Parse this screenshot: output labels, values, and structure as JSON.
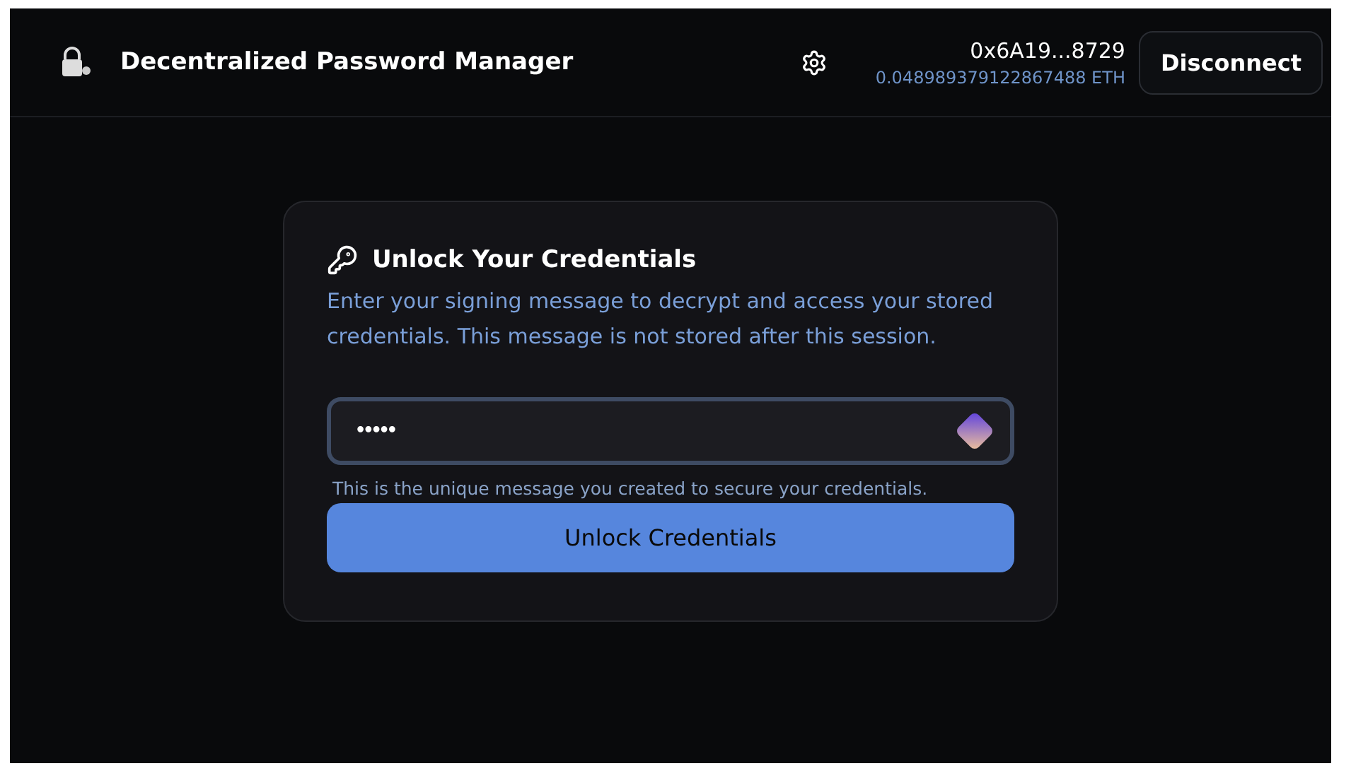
{
  "header": {
    "title": "Decentralized Password Manager",
    "address": "0x6A19...8729",
    "balance": "0.048989379122867488 ETH",
    "disconnect": "Disconnect"
  },
  "card": {
    "title": "Unlock Your Credentials",
    "description": "Enter your signing message to decrypt and access your stored credentials. This message is not stored after this session.",
    "field": {
      "value": "•••••",
      "focused": true
    },
    "hint": "This is the unique message you created to secure your credentials.",
    "button": "Unlock Credentials"
  }
}
